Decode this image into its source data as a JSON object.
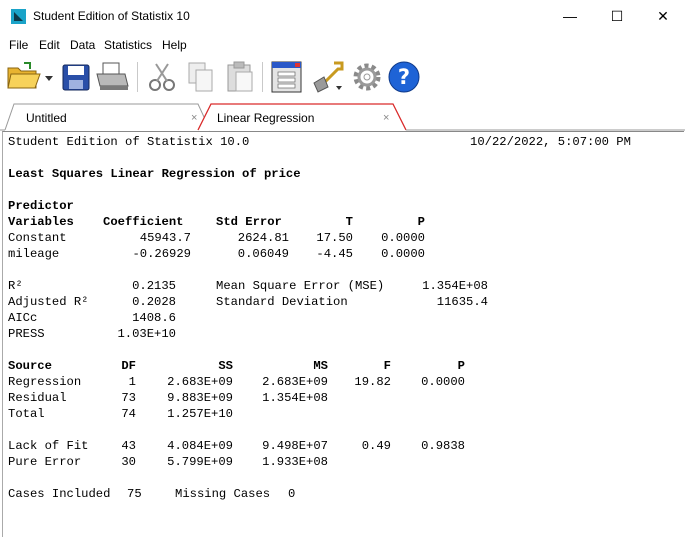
{
  "window": {
    "title": "Student Edition of Statistix 10",
    "minimize": "—",
    "maximize": "☐",
    "close": "✕"
  },
  "menu": [
    "File",
    "Edit",
    "Data",
    "Statistics",
    "Help"
  ],
  "tabs": [
    {
      "label": "Untitled",
      "close": "×"
    },
    {
      "label": "Linear Regression",
      "close": "×"
    }
  ],
  "report": {
    "header_left": "Student Edition of Statistix 10.0",
    "header_right": "10/22/2022, 5:07:00 PM",
    "title": "Least Squares Linear Regression of price",
    "coef_head1": "Predictor",
    "coef_head2": [
      "Variables",
      "Coefficient",
      "Std Error",
      "T",
      "P"
    ],
    "coef_rows": [
      [
        "Constant",
        "45943.7",
        "2624.81",
        "17.50",
        "0.0000"
      ],
      [
        "mileage",
        "-0.26929",
        "0.06049",
        "-4.45",
        "0.0000"
      ]
    ],
    "fit": {
      "r2_label": "R²",
      "r2": "0.2135",
      "adj_label": "Adjusted R²",
      "adj": "0.2028",
      "aicc_label": "AICc",
      "aicc": "1408.6",
      "press_label": "PRESS",
      "press": "1.03E+10",
      "mse_label": "Mean Square Error (MSE)",
      "mse": "1.354E+08",
      "sd_label": "Standard Deviation",
      "sd": "11635.4"
    },
    "anova_head": [
      "Source",
      "DF",
      "SS",
      "MS",
      "F",
      "P"
    ],
    "anova_rows": [
      [
        "Regression",
        "1",
        "2.683E+09",
        "2.683E+09",
        "19.82",
        "0.0000"
      ],
      [
        "Residual",
        "73",
        "9.883E+09",
        "1.354E+08",
        "",
        ""
      ],
      [
        "Total",
        "74",
        "1.257E+10",
        "",
        "",
        ""
      ]
    ],
    "lof_rows": [
      [
        "Lack of Fit",
        "43",
        "4.084E+09",
        "9.498E+07",
        "0.49",
        "0.9838"
      ],
      [
        "Pure Error",
        "30",
        "5.799E+09",
        "1.933E+08",
        "",
        ""
      ]
    ],
    "cases_label": "Cases Included",
    "cases": "75",
    "missing_label": "Missing Cases",
    "missing": "0"
  }
}
